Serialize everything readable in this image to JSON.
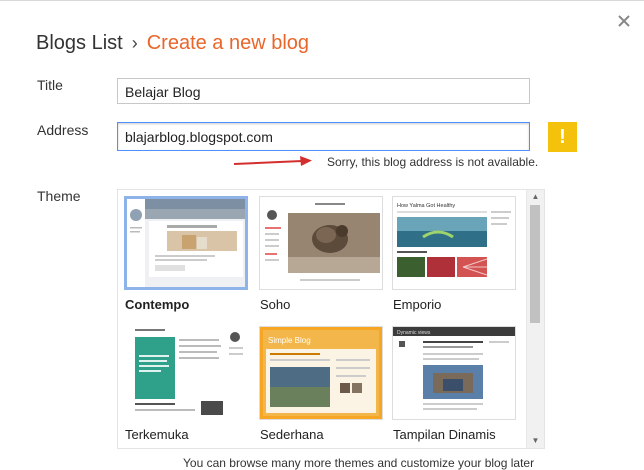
{
  "header": {
    "breadcrumb_root": "Blogs List",
    "separator": "›",
    "breadcrumb_current": "Create a new blog"
  },
  "form": {
    "title_label": "Title",
    "title_value": "Belajar Blog",
    "address_label": "Address",
    "address_value": "blajarblog.blogspot.com",
    "address_warning_symbol": "!",
    "address_error": "Sorry, this blog address is not available.",
    "theme_label": "Theme"
  },
  "themes": [
    {
      "name": "Contempo",
      "selected": true
    },
    {
      "name": "Soho",
      "selected": false
    },
    {
      "name": "Emporio",
      "selected": false
    },
    {
      "name": "Terkemuka",
      "selected": false
    },
    {
      "name": "Sederhana",
      "selected": false
    },
    {
      "name": "Tampilan Dinamis",
      "selected": false
    }
  ],
  "thumbnail_text": {
    "emporio_heading": "How Yalma Got Healthy",
    "sederhana_heading": "Simple Blog",
    "dinamis_heading": "Dynamic views"
  },
  "footer_note": "You can browse many more themes and customize your blog later",
  "icons": {
    "close": "close-icon",
    "warning": "warning-icon",
    "arrow": "red-arrow-icon"
  },
  "colors": {
    "accent": "#e8662a",
    "warning": "#f4c20d",
    "focus": "#4d90fe",
    "selected_border": "#8eb3e8"
  }
}
